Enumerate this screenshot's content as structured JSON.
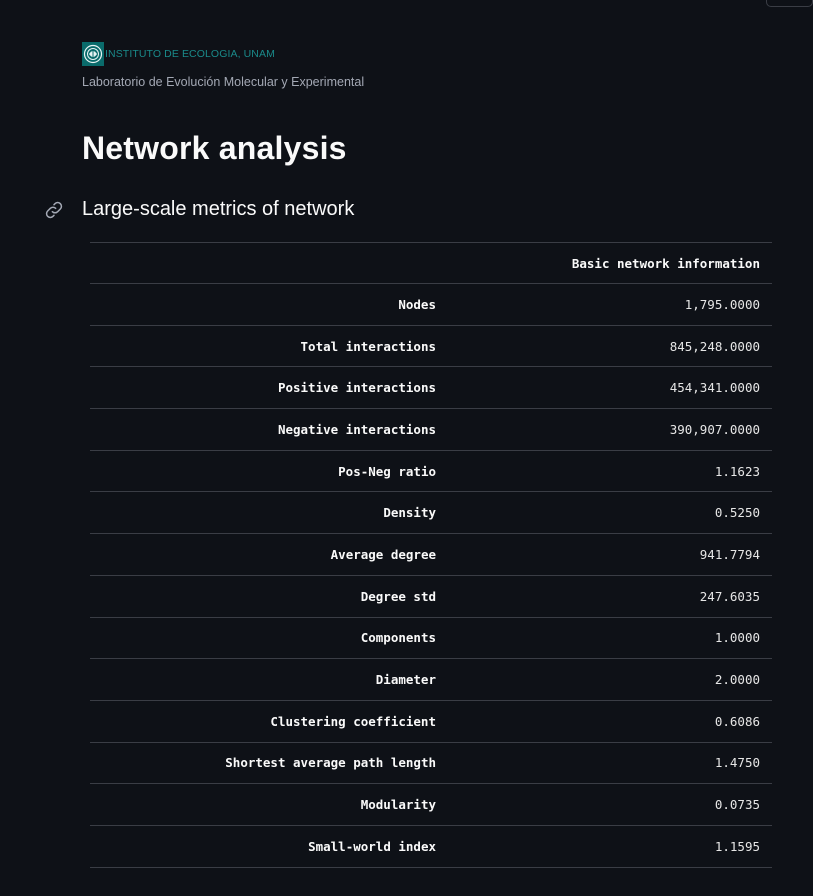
{
  "brand": {
    "institute_name": "INSTITUTO DE ECOLOGIA, UNAM",
    "lab_name": "Laboratorio de Evolución Molecular y Experimental"
  },
  "page": {
    "title": "Network analysis"
  },
  "section": {
    "title": "Large-scale metrics of network",
    "anchor_icon": "link-icon"
  },
  "table": {
    "index_header": "",
    "column_header": "Basic network information",
    "rows": [
      {
        "label": "Nodes",
        "value": "1,795.0000"
      },
      {
        "label": "Total interactions",
        "value": "845,248.0000"
      },
      {
        "label": "Positive interactions",
        "value": "454,341.0000"
      },
      {
        "label": "Negative interactions",
        "value": "390,907.0000"
      },
      {
        "label": "Pos-Neg ratio",
        "value": "1.1623"
      },
      {
        "label": "Density",
        "value": "0.5250"
      },
      {
        "label": "Average degree",
        "value": "941.7794"
      },
      {
        "label": "Degree std",
        "value": "247.6035"
      },
      {
        "label": "Components",
        "value": "1.0000"
      },
      {
        "label": "Diameter",
        "value": "2.0000"
      },
      {
        "label": "Clustering coefficient",
        "value": "0.6086"
      },
      {
        "label": "Shortest average path length",
        "value": "1.4750"
      },
      {
        "label": "Modularity",
        "value": "0.0735"
      },
      {
        "label": "Small-world index",
        "value": "1.1595"
      }
    ]
  },
  "colors": {
    "background": "#0e1117",
    "text": "#fafafa",
    "brand_teal": "#1a8a8a",
    "muted_text": "#a3a8b4",
    "divider": "#3a3d45"
  }
}
